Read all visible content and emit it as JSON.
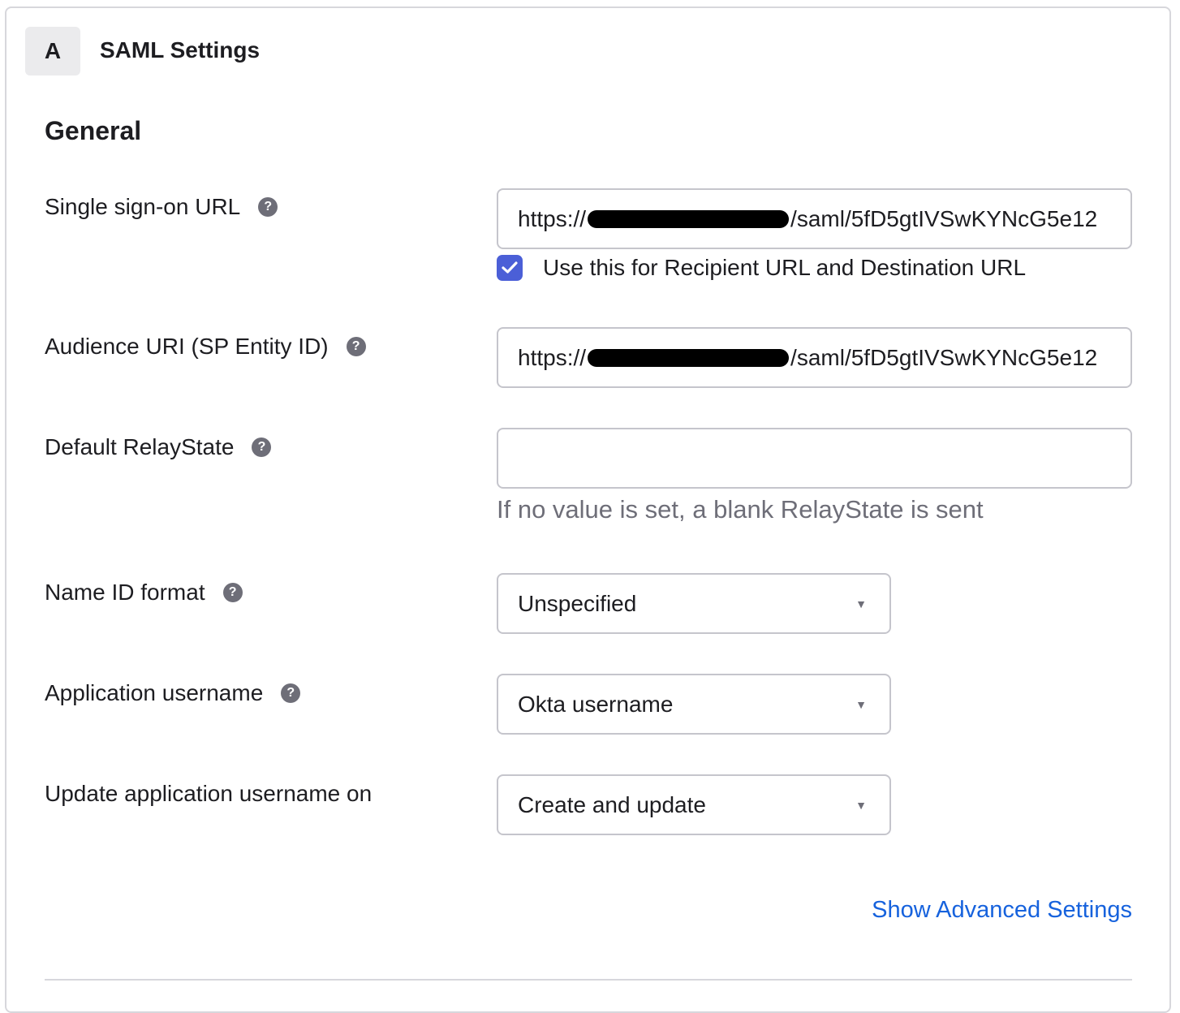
{
  "card": {
    "step_letter": "A",
    "title": "SAML Settings"
  },
  "section": {
    "title": "General"
  },
  "fields": {
    "sso_url": {
      "label": "Single sign-on URL",
      "value_prefix": "https://",
      "value_suffix": "/saml/5fD5gtIVSwKYNcG5e12"
    },
    "recipient_checkbox": {
      "label": "Use this for Recipient URL and Destination URL",
      "checked": true
    },
    "audience_uri": {
      "label": "Audience URI (SP Entity ID)",
      "value_prefix": "https://",
      "value_suffix": "/saml/5fD5gtIVSwKYNcG5e12"
    },
    "relay_state": {
      "label": "Default RelayState",
      "value": "",
      "hint": "If no value is set, a blank RelayState is sent"
    },
    "name_id_format": {
      "label": "Name ID format",
      "selected": "Unspecified"
    },
    "app_username": {
      "label": "Application username",
      "selected": "Okta username"
    },
    "update_username_on": {
      "label": "Update application username on",
      "selected": "Create and update"
    }
  },
  "help_glyph": "?",
  "caret_glyph": "▼",
  "advanced_link": "Show Advanced Settings",
  "colors": {
    "accent": "#4b5fd7",
    "link": "#1662dd",
    "border": "#c5c5cc",
    "muted_text": "#6e6e78"
  }
}
